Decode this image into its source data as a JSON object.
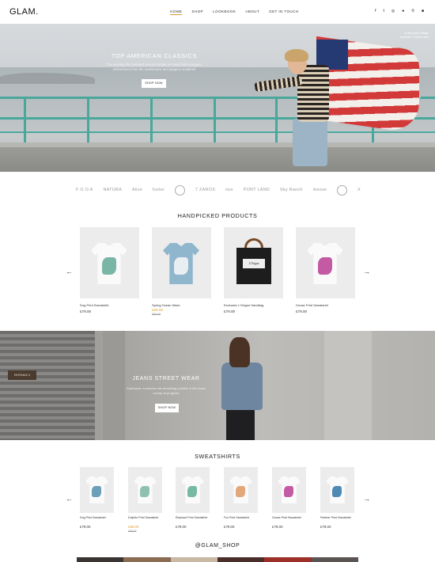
{
  "header": {
    "logo": "GLAM.",
    "nav": [
      "HOME",
      "SHOP",
      "LOOKBOOK",
      "ABOUT",
      "GET IN TOUCH"
    ],
    "active_nav": "HOME",
    "social_icons": [
      "facebook-icon",
      "twitter-icon",
      "instagram-icon",
      "user-icon",
      "search-icon",
      "cart-icon"
    ]
  },
  "hero": {
    "title": "TOP AMERICAN CLASSICS",
    "text": "The evening this featured several tongue-in-cheek hallucinogenic refreshment from the mushrooms and peppers scattered",
    "button": "SHOP NOW",
    "credit": "In this photo Vintage American T-Shirts Levi's"
  },
  "brands": [
    "F O O A",
    "NATURA",
    "Alice",
    "foxter",
    "ooo",
    "7 ZAROS",
    "ooo",
    "PORT LAND",
    "Sky Ranch",
    "moose",
    "ooo",
    "X"
  ],
  "handpicked": {
    "title": "HANDPICKED PRODUCTS",
    "items": [
      {
        "name": "Dog Print Sweatshirt",
        "price": "£79.00",
        "sale": "",
        "old": ""
      },
      {
        "name": "Spring Ocean Wave",
        "price": "",
        "sale": "£69.00",
        "old": "£85.00"
      },
      {
        "name": "Exclusive L'Origan Handbag",
        "price": "£79.00",
        "sale": "",
        "old": ""
      },
      {
        "name": "Goose Print Sweatshirt",
        "price": "£79.00",
        "sale": "",
        "old": ""
      }
    ],
    "bag_label": "L'Origan"
  },
  "street": {
    "title": "JEANS STREET WEAR",
    "text": "Eyebrows: a summer set remaining positive in the usual course of progress",
    "button": "SHOP NOW",
    "sign": "ENTRANCE 3"
  },
  "sweatshirts": {
    "title": "SWEATSHIRTS",
    "items": [
      {
        "name": "Dog Print Sweatshirt",
        "price": "£79.00",
        "sale": "",
        "old": ""
      },
      {
        "name": "Dolphin Print Sweatshirt",
        "price": "",
        "sale": "£69.00",
        "old": "£85.00"
      },
      {
        "name": "Elephant Print Sweatshirt",
        "price": "£79.00",
        "sale": "",
        "old": ""
      },
      {
        "name": "Fox Print Sweatshirt",
        "price": "£79.00",
        "sale": "",
        "old": ""
      },
      {
        "name": "Goose Print Sweatshirt",
        "price": "£79.00",
        "sale": "",
        "old": ""
      },
      {
        "name": "Panther Print Sweatshirt",
        "price": "£79.00",
        "sale": "",
        "old": ""
      }
    ]
  },
  "instagram": {
    "title": "@GLAM_SHOP"
  },
  "colors": {
    "accent": "#e0a030",
    "rail": "#4aa79c"
  }
}
